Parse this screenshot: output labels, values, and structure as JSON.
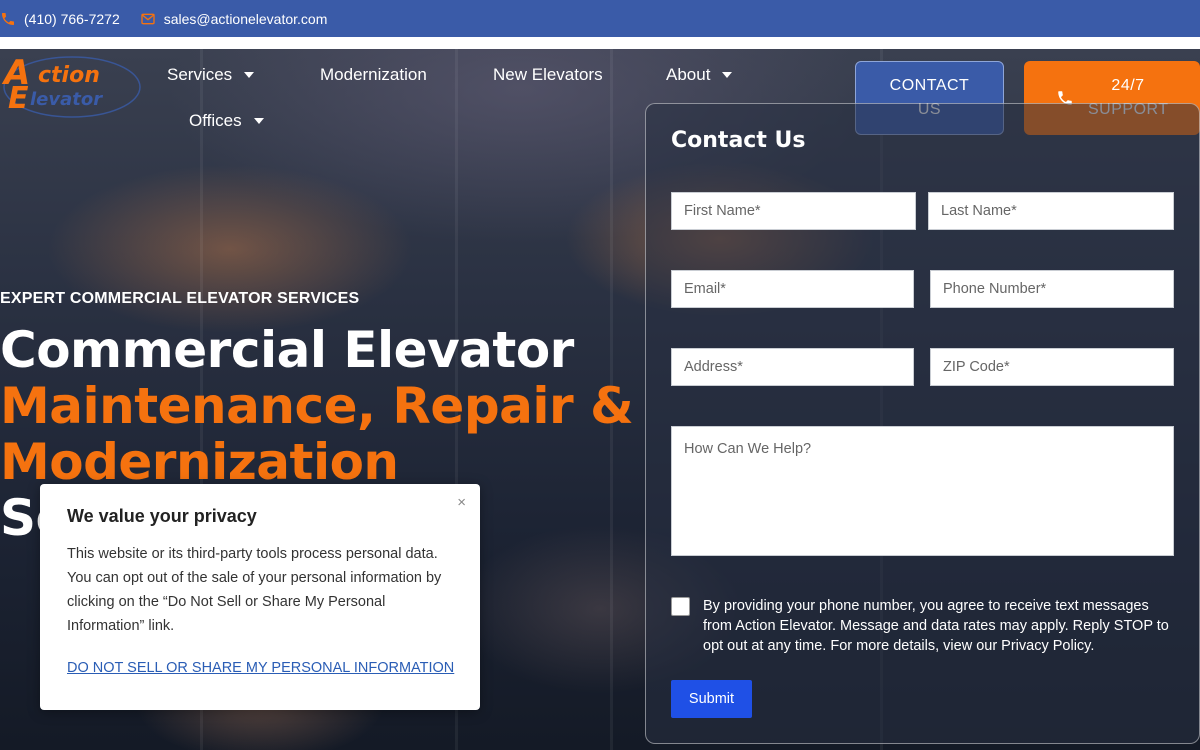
{
  "topbar": {
    "phone": "(410) 766-7272",
    "email": "sales@actionelevator.com"
  },
  "brand": {
    "logo_line1": "Action",
    "logo_line2": "Elevator",
    "accent": "#f5720f",
    "blue": "#3a5ba8"
  },
  "nav": {
    "items": [
      {
        "label": "Services"
      },
      {
        "label": "Modernization"
      },
      {
        "label": "New Elevators"
      },
      {
        "label": "About"
      },
      {
        "label": "Offices"
      }
    ]
  },
  "header_buttons": {
    "contact": "CONTACT US",
    "support": "24/7 SUPPORT"
  },
  "hero": {
    "eyebrow": "EXPERT COMMERCIAL ELEVATOR SERVICES",
    "line1": "Commercial Elevator",
    "line2": "Maintenance, Repair &",
    "line3": "Modernization",
    "line4": "Se"
  },
  "form": {
    "title": "Contact Us",
    "first_name": "First Name*",
    "last_name": "Last Name*",
    "email": "Email*",
    "phone": "Phone Number*",
    "address": "Address*",
    "zip": "ZIP Code*",
    "message": "How Can We Help?",
    "consent": "By providing your phone number, you agree to receive text messages from Action Elevator. Message and data rates may apply. Reply STOP to opt out at any time. For more details, view our Privacy Policy.",
    "submit": "Submit"
  },
  "privacy": {
    "title": "We value your privacy",
    "body": "This website or its third-party tools process personal data. You can opt out of the sale of your personal information by clicking on the “Do Not Sell or Share My Personal Information” link.",
    "link": "DO NOT SELL OR SHARE MY PERSONAL INFORMATION",
    "close": "×"
  }
}
